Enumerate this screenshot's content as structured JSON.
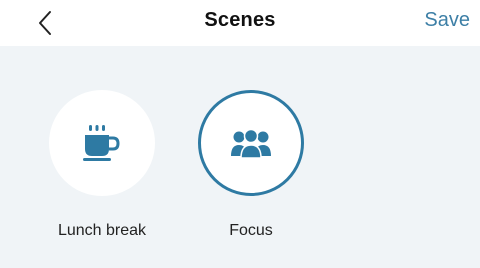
{
  "header": {
    "title": "Scenes",
    "save_label": "Save",
    "back_icon": "chevron-left-icon"
  },
  "colors": {
    "accent": "#2e7aa3",
    "link": "#3d7fa6",
    "background": "#f0f4f7"
  },
  "scenes": [
    {
      "label": "Lunch break",
      "icon": "coffee-cup-icon",
      "selected": false
    },
    {
      "label": "Focus",
      "icon": "people-group-icon",
      "selected": true
    }
  ]
}
